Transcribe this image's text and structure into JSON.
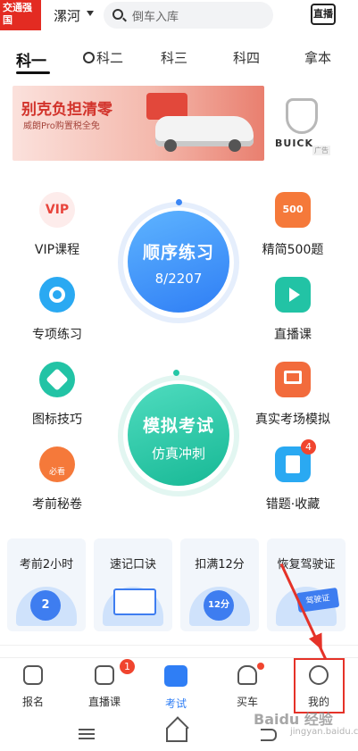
{
  "header": {
    "badge_text": "交通强国",
    "city": "漯河",
    "search_placeholder": "倒车入库",
    "live_label": "直播"
  },
  "tabs": [
    "科一",
    "科二",
    "科三",
    "科四",
    "拿本"
  ],
  "banner": {
    "title": "别克负担清零",
    "subtitle": "威朗Pro购置税全免",
    "brand": "BUICK",
    "ad_tag": "广告"
  },
  "functions": {
    "vip": {
      "icon_text": "VIP",
      "label": "VIP课程"
    },
    "jingjian": {
      "icon_text": "500",
      "label": "精简500题"
    },
    "zhuanxiang": {
      "label": "专项练习"
    },
    "zhibo": {
      "label": "直播课"
    },
    "tubiao": {
      "label": "图标技巧"
    },
    "zhenshi": {
      "label": "真实考场模拟"
    },
    "miju": {
      "icon_text": "必看",
      "label": "考前秘卷"
    },
    "cuoti": {
      "label": "错题·收藏",
      "badge": "4"
    }
  },
  "practice": {
    "title": "顺序练习",
    "progress": "8/2207"
  },
  "exam": {
    "title": "模拟考试",
    "subtitle": "仿真冲刺"
  },
  "cards": [
    {
      "title": "考前2小时",
      "art": "2"
    },
    {
      "title": "速记口诀",
      "art": ""
    },
    {
      "title": "扣满12分",
      "art": "12分"
    },
    {
      "title": "恢复驾驶证",
      "art": "驾驶证"
    }
  ],
  "bottom_nav": {
    "items": [
      "报名",
      "直播课",
      "考试",
      "买车",
      "我的"
    ],
    "live_badge": "1"
  },
  "watermark": {
    "main": "Baidu 经验",
    "sub": "jingyan.baidu.com"
  },
  "colors": {
    "accent_blue": "#2f7ef5",
    "accent_green": "#23c7a6",
    "badge_red": "#f0452f",
    "annotation_red": "#e53228"
  }
}
